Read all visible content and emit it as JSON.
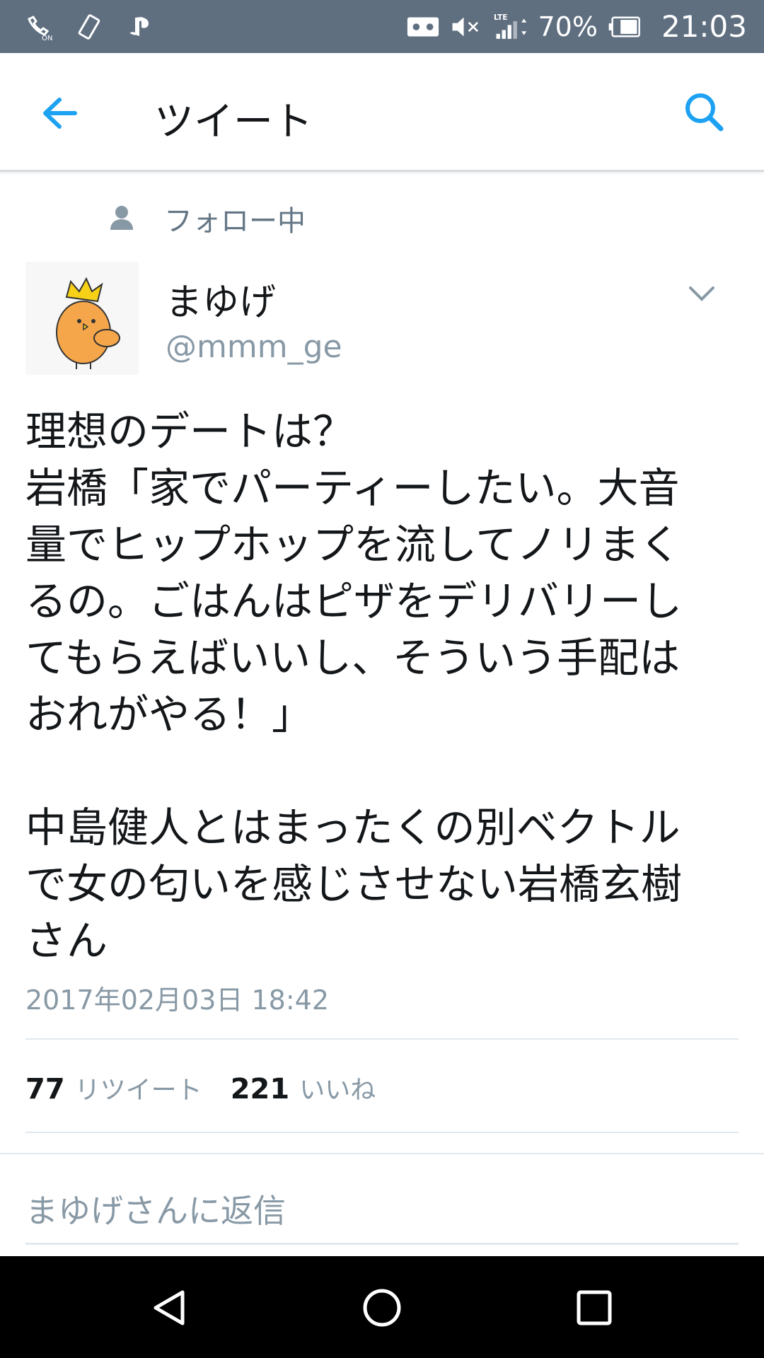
{
  "status_bar": {
    "battery": "70%",
    "time": "21:03",
    "network": "LTE"
  },
  "app_bar": {
    "title": "ツイート"
  },
  "tweet": {
    "following_label": "フォロー中",
    "display_name": "まゆげ",
    "handle": "@mmm_ge",
    "text": "理想のデートは？\n岩橋「家でパーティーしたい。大音\n量でヒップホップを流してノリまく\nるの。ごはんはピザをデリバリーし\nてもらえばいいし、そういう手配は\nおれがやる！」\n\n中島健人とはまったくの別ベクトル\nで女の匂いを感じさせない岩橋玄樹\nさん",
    "timestamp": "2017年02月03日 18:42",
    "retweet_count": "77",
    "retweet_label": "リツイート",
    "like_count": "221",
    "like_label": "いいね"
  },
  "reply": {
    "placeholder": "まゆげさんに返信"
  },
  "colors": {
    "status_bar": "#5f6f80",
    "accent": "#1da1f2",
    "secondary_text": "#8899a6"
  }
}
